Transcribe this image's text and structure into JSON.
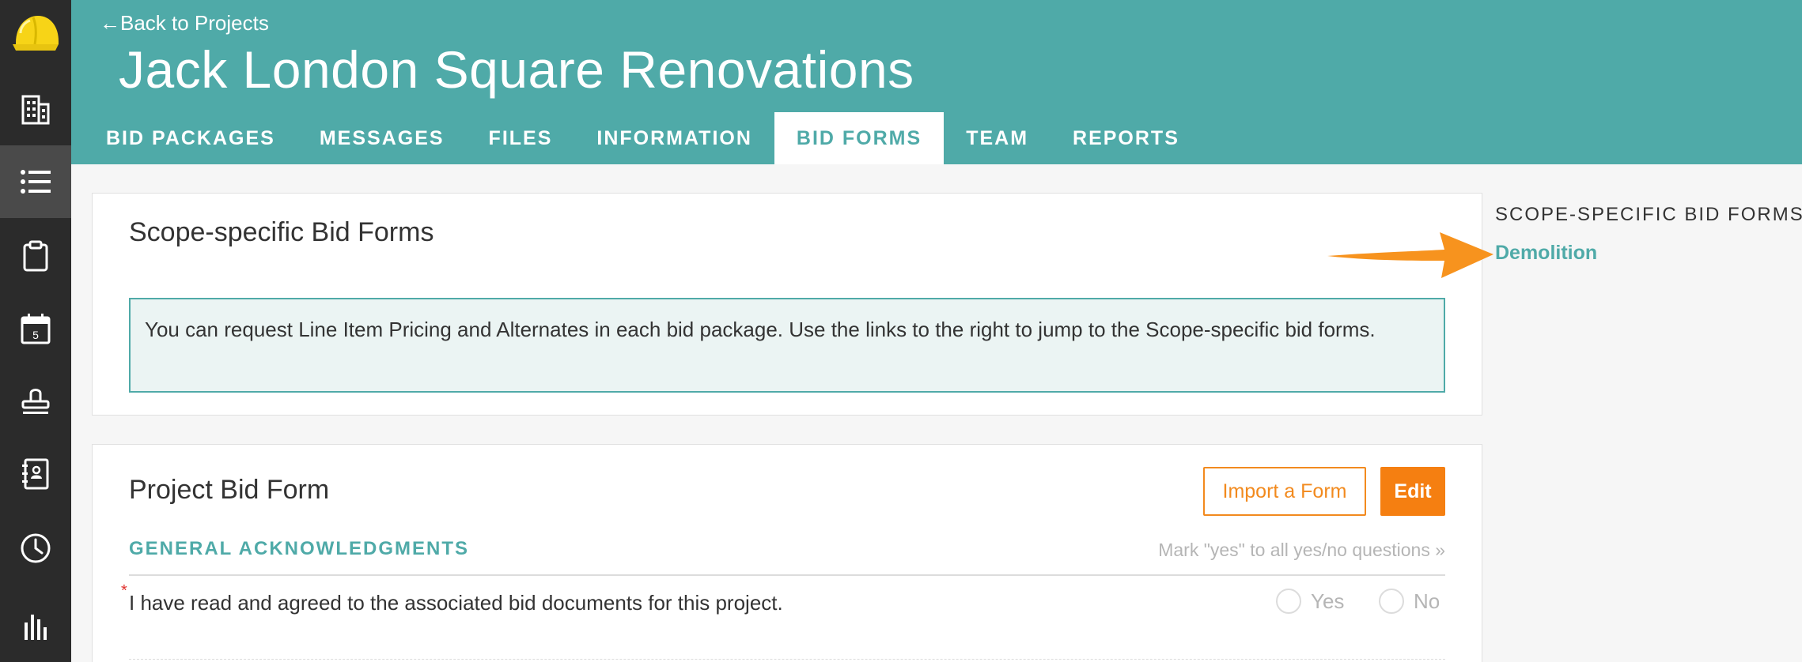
{
  "header": {
    "back_label": "Back to Projects",
    "back_arrow": "←",
    "project_title": "Jack London Square Renovations"
  },
  "rail": {
    "icons": [
      "hardhat-logo-icon",
      "building-icon",
      "list-icon",
      "clipboard-icon",
      "calendar-icon",
      "stamp-icon",
      "contacts-book-icon",
      "clock-icon",
      "bar-chart-icon"
    ],
    "calendar_day": "5"
  },
  "tabs": [
    {
      "label": "BID PACKAGES"
    },
    {
      "label": "MESSAGES"
    },
    {
      "label": "FILES"
    },
    {
      "label": "INFORMATION"
    },
    {
      "label": "BID FORMS"
    },
    {
      "label": "TEAM"
    },
    {
      "label": "REPORTS"
    }
  ],
  "scope_panel": {
    "title": "Scope-specific Bid Forms",
    "info_text": "You can request Line Item Pricing and Alternates in each bid package. Use the links to the right to jump to the Scope-specific bid forms."
  },
  "project_panel": {
    "title": "Project Bid Form",
    "import_label": "Import a Form",
    "edit_label": "Edit",
    "section_title": "GENERAL ACKNOWLEDGMENTS",
    "mark_all_label": "Mark \"yes\" to all yes/no questions »",
    "question": {
      "required_marker": "*",
      "text": "I have read and agreed to the associated bid documents for this project.",
      "yes_label": "Yes",
      "no_label": "No"
    }
  },
  "sidebar": {
    "heading": "SCOPE-SPECIFIC BID FORMS:",
    "links": [
      "Demolition"
    ]
  },
  "colors": {
    "teal": "#4faaa8",
    "orange": "#f57f11",
    "rail": "#2b2b2b",
    "active_rail": "#4a4a4a",
    "arrow": "#f7931e"
  }
}
